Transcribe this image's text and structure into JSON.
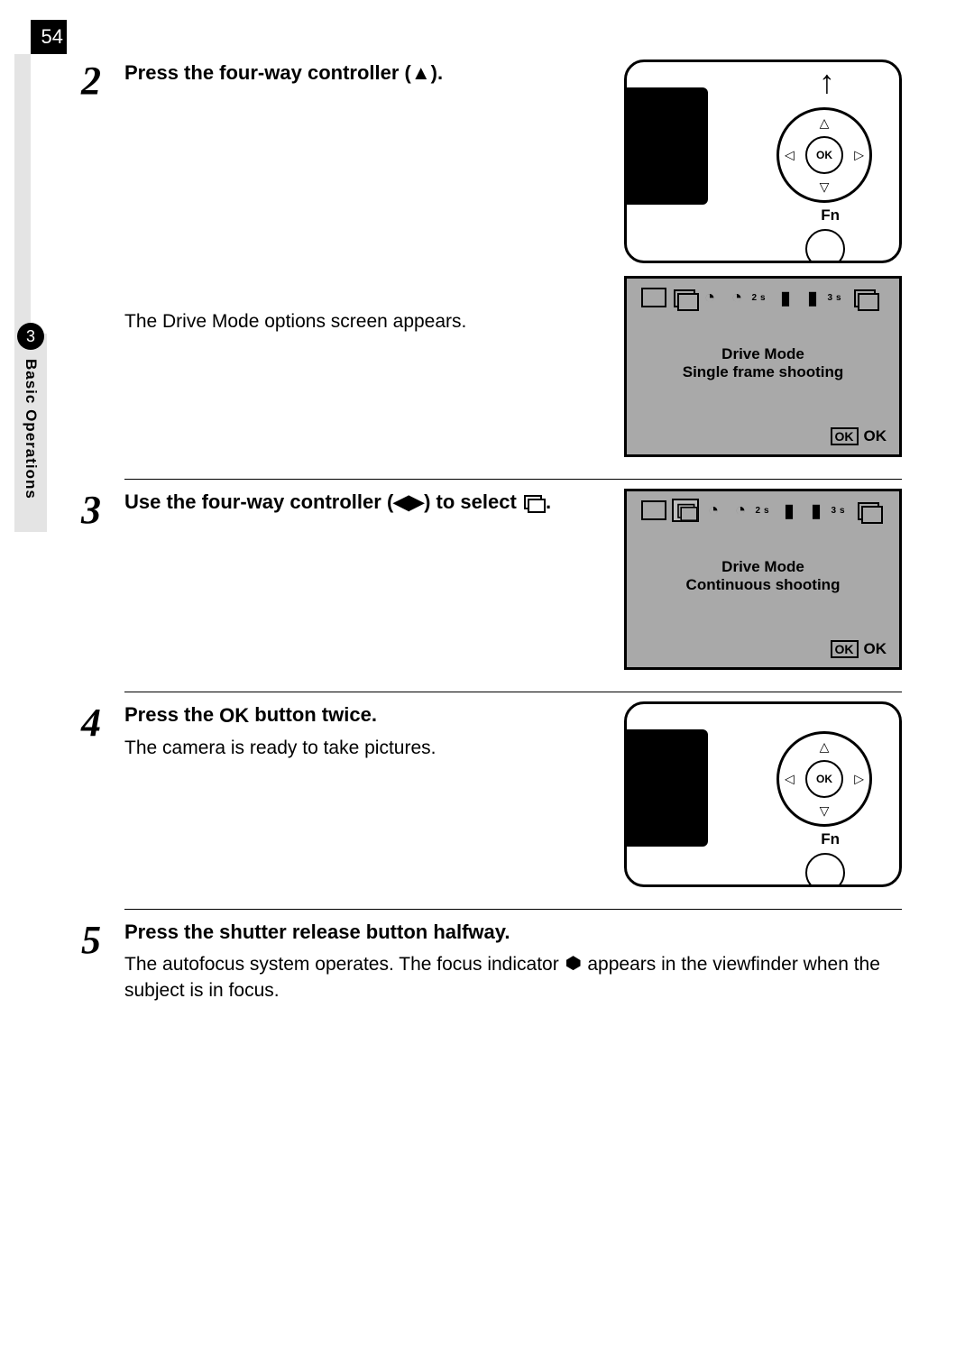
{
  "page_number": "54",
  "chapter_number": "3",
  "vertical_label": "Basic Operations",
  "steps": {
    "s2": {
      "num": "2",
      "heading_a": "Press the four-way controller ",
      "heading_b": "(▲).",
      "body": "The Drive Mode options screen appears."
    },
    "s3": {
      "num": "3",
      "heading_a": "Use the four-way controller ",
      "heading_b": "(◀▶) to select ",
      "heading_c": "."
    },
    "s4": {
      "num": "4",
      "heading_a": "Press the ",
      "heading_ok": "OK",
      "heading_b": " button twice.",
      "body": "The camera is ready to take pictures."
    },
    "s5": {
      "num": "5",
      "heading": "Press the shutter release button halfway.",
      "body_a": "The autofocus system operates. The focus indicator ",
      "body_b": " appears in the viewfinder when the subject is in focus."
    }
  },
  "illus": {
    "ok": "OK",
    "fn": "Fn",
    "up_arrow": "↑"
  },
  "lcd1": {
    "title": "Drive Mode",
    "subtitle": "Single frame shooting",
    "ok_box": "OK",
    "ok_text": "OK"
  },
  "lcd2": {
    "title": "Drive Mode",
    "subtitle": "Continuous shooting",
    "ok_box": "OK",
    "ok_text": "OK"
  },
  "icons": {
    "sub_2s": "2s",
    "sub_3s": "3s"
  }
}
